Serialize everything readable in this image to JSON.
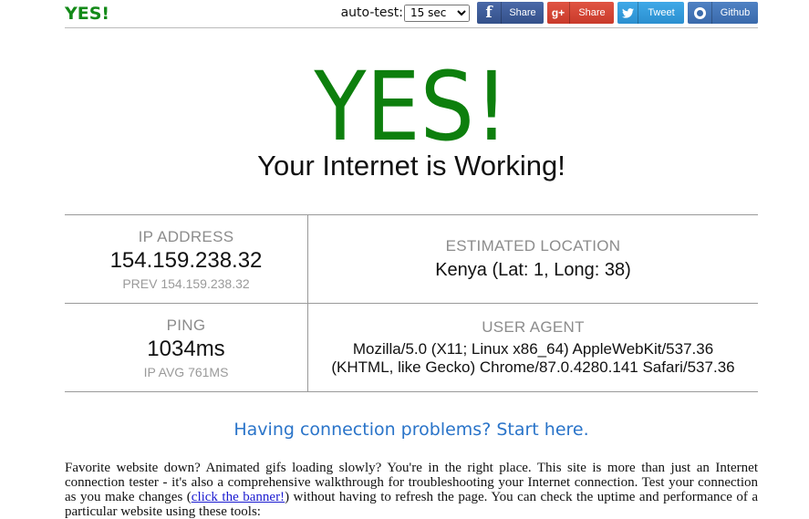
{
  "header": {
    "brand": "YES!",
    "autotest_label": "auto-test:",
    "autotest_selected": "15 sec",
    "buttons": {
      "facebook": {
        "icon": "f",
        "label": "Share"
      },
      "googleplus": {
        "icon": "g+",
        "label": "Share"
      },
      "twitter": {
        "icon": "♥",
        "label": "Tweet"
      },
      "github": {
        "label": "Github"
      }
    }
  },
  "hero": {
    "title": "YES!",
    "subtitle": "Your Internet is Working!"
  },
  "info": {
    "ip": {
      "label": "IP ADDRESS",
      "value": "154.159.238.32",
      "prev": "PREV 154.159.238.32"
    },
    "location": {
      "label": "ESTIMATED LOCATION",
      "value": "Kenya (Lat: 1, Long: 38)"
    },
    "ping": {
      "label": "PING",
      "value": "1034ms",
      "avg": "IP AVG 761MS"
    },
    "user_agent": {
      "label": "USER AGENT",
      "line1": "Mozilla/5.0 (X11; Linux x86_64) AppleWebKit/537.36",
      "line2": "(KHTML, like Gecko) Chrome/87.0.4280.141 Safari/537.36"
    }
  },
  "help": {
    "link_text": "Having connection problems? Start here."
  },
  "paragraph": {
    "part1": "Favorite website down? Animated gifs loading slowly? You're in the right place. This site is more than just an Internet connection tester - it's also a comprehensive walkthrough for troubleshooting your Internet connection. Test your connection as you make changes (",
    "link": "click the banner!",
    "part2": ") without having to refresh the page. You can check the uptime and performance of a particular website using these tools:"
  }
}
